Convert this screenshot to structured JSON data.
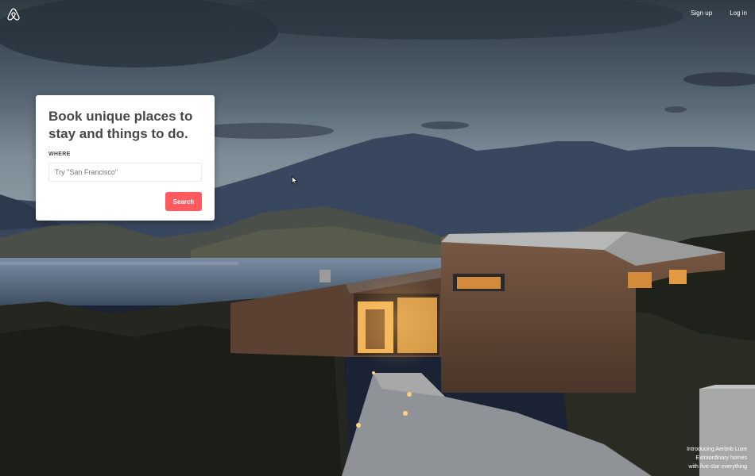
{
  "brand": {
    "logo_icon": "airbnb-belo-icon",
    "accent_color": "#ff5a5f"
  },
  "nav": {
    "sign_up": "Sign up",
    "log_in": "Log in"
  },
  "card": {
    "heading": "Book unique places to stay and things to do.",
    "where_label": "WHERE",
    "where_placeholder": "Try \"San Francisco\"",
    "search_label": "Search"
  },
  "promo": {
    "line1": "Introducing Aerbnb Luxe",
    "line2": "Extraordinary homes",
    "line3": "with five-star everything"
  }
}
